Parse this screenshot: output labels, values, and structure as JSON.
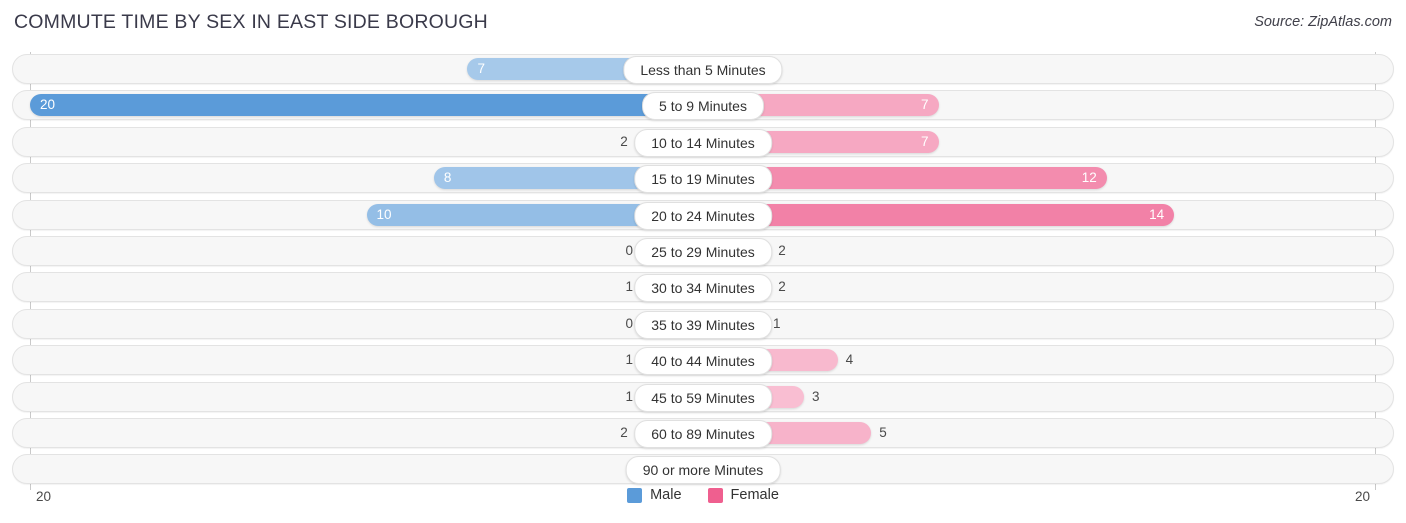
{
  "header": {
    "title": "COMMUTE TIME BY SEX IN EAST SIDE BOROUGH",
    "source": "Source: ZipAtlas.com"
  },
  "axis": {
    "left_max_label": "20",
    "right_max_label": "20"
  },
  "legend": {
    "items": [
      {
        "label": "Male",
        "color": "#5b9bd9"
      },
      {
        "label": "Female",
        "color": "#ef5f8f"
      }
    ]
  },
  "chart_data": {
    "type": "bar",
    "title": "COMMUTE TIME BY SEX IN EAST SIDE BOROUGH",
    "subtitle": "Source: ZipAtlas.com",
    "orientation": "horizontal-diverging",
    "xlabel": "",
    "ylabel": "",
    "xlim": [
      20,
      20
    ],
    "grid": false,
    "legend_position": "bottom-center",
    "categories": [
      "Less than 5 Minutes",
      "5 to 9 Minutes",
      "10 to 14 Minutes",
      "15 to 19 Minutes",
      "20 to 24 Minutes",
      "25 to 29 Minutes",
      "30 to 34 Minutes",
      "35 to 39 Minutes",
      "40 to 44 Minutes",
      "45 to 59 Minutes",
      "60 to 89 Minutes",
      "90 or more Minutes"
    ],
    "series": [
      {
        "name": "Male",
        "side": "left",
        "color": "#5b9bd9",
        "values": [
          7,
          20,
          2,
          8,
          10,
          0,
          1,
          0,
          1,
          1,
          2,
          0
        ]
      },
      {
        "name": "Female",
        "side": "right",
        "color": "#ef5f8f",
        "values": [
          0,
          7,
          7,
          12,
          14,
          2,
          2,
          1,
          4,
          3,
          5,
          0
        ]
      }
    ]
  }
}
